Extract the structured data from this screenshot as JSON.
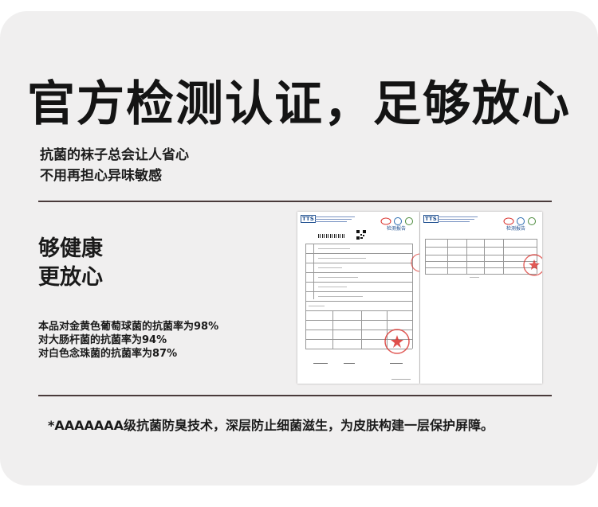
{
  "headline": "官方检测认证，足够放心",
  "intro": {
    "line1": "抗菌的袜子总会让人省心",
    "line2": "不用再担心异味敏感"
  },
  "emphasis": {
    "line1": "够健康",
    "line2": "更放心"
  },
  "rates": [
    "本品对金黄色葡萄球菌的抗菌率为98%",
    "对大肠杆菌的抗菌率为94%",
    "对白色念珠菌的抗菌率为87%"
  ],
  "footnote": "*AAAAAAA级抗菌防臭技术，深层防止细菌滋生，为皮肤构建一层保护屏障。",
  "report": {
    "logo": "TTS",
    "title1": "检测报告",
    "title2": "检测报告"
  },
  "colors": {
    "card": "#f0efef",
    "rule": "#4a3b3b",
    "stamp": "#d9302b"
  }
}
